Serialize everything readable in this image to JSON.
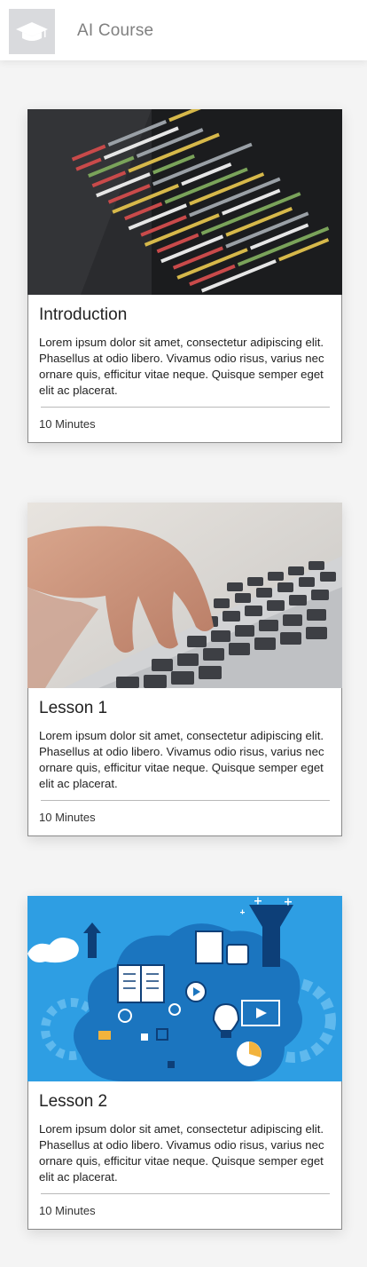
{
  "header": {
    "title": "AI Course",
    "logo_icon": "graduation-cap-icon"
  },
  "lessons": [
    {
      "title": "Introduction",
      "description": "Lorem ipsum dolor sit amet, consectetur adipiscing elit. Phasellus at odio libero. Vivamus odio risus, varius nec ornare quis, efficitur vitae neque. Quisque semper eget elit ac placerat.",
      "duration": "10 Minutes",
      "image": "code-editor-photo"
    },
    {
      "title": "Lesson 1",
      "description": "Lorem ipsum dolor sit amet, consectetur adipiscing elit. Phasellus at odio libero. Vivamus odio risus, varius nec ornare quis, efficitur vitae neque. Quisque semper eget elit ac placerat.",
      "duration": "10 Minutes",
      "image": "laptop-typing-photo"
    },
    {
      "title": "Lesson 2",
      "description": "Lorem ipsum dolor sit amet, consectetur adipiscing elit. Phasellus at odio libero. Vivamus odio risus, varius nec ornare quis, efficitur vitae neque. Quisque semper eget elit ac placerat.",
      "duration": "10 Minutes",
      "image": "ai-brain-illustration"
    }
  ]
}
